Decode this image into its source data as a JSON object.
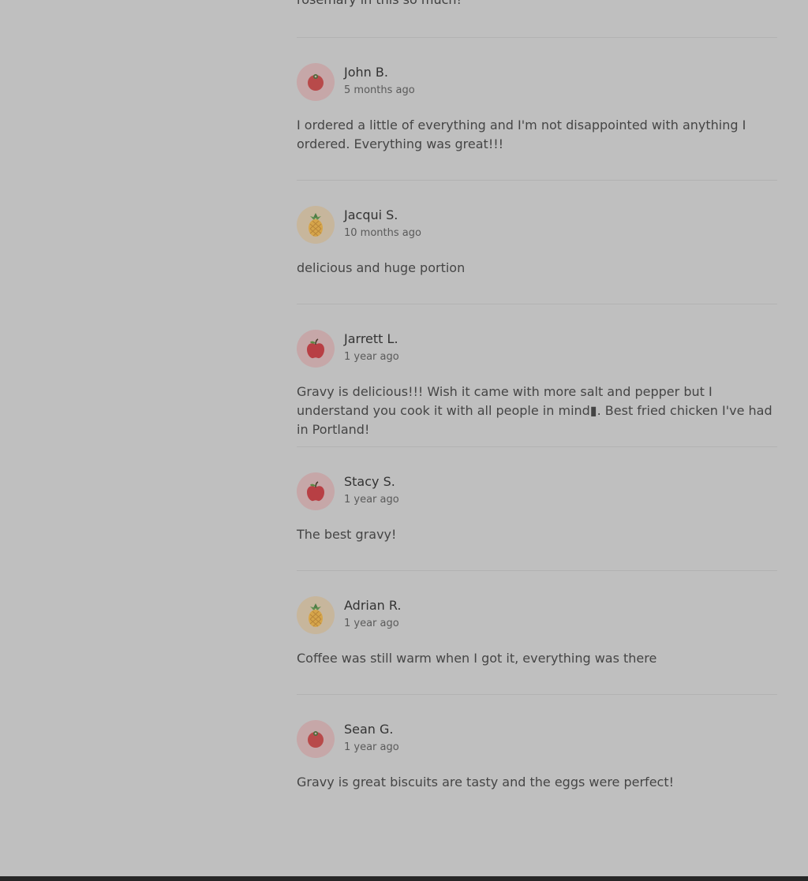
{
  "top_text": "rosemary in this so much!",
  "reviews": [
    {
      "name": "John B.",
      "time": "5 months ago",
      "text": "I ordered a little of everything and I'm not disappointed with anything I ordered. Everything was great!!!",
      "avatar": "tomato-icon",
      "avatar_color": "#c6a7a8"
    },
    {
      "name": "Jacqui S.",
      "time": "10 months ago",
      "text": "delicious and huge portion",
      "avatar": "pineapple-icon",
      "avatar_color": "#c7b69c"
    },
    {
      "name": "Jarrett L.",
      "time": "1 year ago",
      "text": "Gravy is delicious!!! Wish it came with more salt and pepper but I understand you cook it with all people in mind▮. Best fried chicken I've had in Portland!",
      "avatar": "apple-icon",
      "avatar_color": "#c6a7a8"
    },
    {
      "name": "Stacy S.",
      "time": "1 year ago",
      "text": "The best gravy!",
      "avatar": "apple-icon",
      "avatar_color": "#c6a7a8"
    },
    {
      "name": "Adrian R.",
      "time": "1 year ago",
      "text": "Coffee was still warm when I got it, everything was there",
      "avatar": "pineapple-icon",
      "avatar_color": "#c7b69c"
    },
    {
      "name": "Sean G.",
      "time": "1 year ago",
      "text": "Gravy is great biscuits are tasty and the eggs were perfect!",
      "avatar": "tomato-icon",
      "avatar_color": "#c6a7a8"
    }
  ]
}
